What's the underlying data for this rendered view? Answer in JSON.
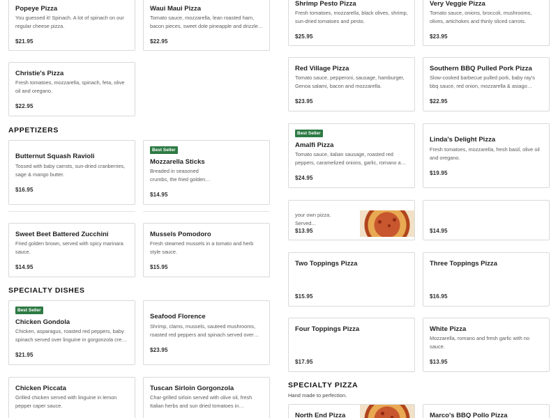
{
  "sections": {
    "appetizers": "APPETIZERS",
    "specialty_dishes": "SPECIALTY DISHES",
    "specialty_pizza": "SPECIALTY PIZZA",
    "specialty_pizza_sub": "Hand made to perfection."
  },
  "badge_label": "Best Seller",
  "items": {
    "popeye": {
      "name": "Popeye Pizza",
      "desc": "You guessed it! Spinach. A lot of spinach on our regular cheese pizza.",
      "price": "$21.95"
    },
    "waui_maui": {
      "name": "Waui Maui Pizza",
      "desc": "Tomato sauce, mozzarella, lean roasted ham, bacon pieces, sweet dole pineapple and drizzle of honey.",
      "price": "$22.95"
    },
    "shrimp_pesto": {
      "name": "Shrimp Pesto Pizza",
      "desc": "Fresh tomatoes, mozzarella, black olives, shrimp, sun-dried tomatoes and pesto.",
      "price": "$25.95"
    },
    "very_veggie": {
      "name": "Very Veggie Pizza",
      "desc": "Tomato sauce, onions, broccoli, mushrooms, olives, artichokes and thinly sliced carrots.",
      "price": "$23.95"
    },
    "christies": {
      "name": "Christie's Pizza",
      "desc": "Fresh tomatoes, mozzarella, spinach, feta, olive oil and oregano.",
      "price": "$22.95"
    },
    "red_village": {
      "name": "Red Village Pizza",
      "desc": "Tomato sauce, pepperoni, sausage, hamburger, Genoa salami, bacon and mozzarella.",
      "price": "$23.95"
    },
    "southern_bbq": {
      "name": "Southern BBQ Pulled Pork Pizza",
      "desc": "Slow-cooked barbecue pulled pork, baby ray's bbq sauce, red onion, mozzarella & asiago cheese.",
      "price": "$22.95"
    },
    "butternut": {
      "name": "Butternut Squash Ravioli",
      "desc": "Tossed with baby carrots, sun-dried cranberries, sage & mango butter.",
      "price": "$16.95"
    },
    "mozzarella_sticks": {
      "name": "Mozzarella Sticks",
      "desc": "Breaded in seasoned crumbs, the fried golden brown.",
      "price": "$14.95"
    },
    "amalfi": {
      "name": "Amalfi Pizza",
      "desc": "Tomato sauce, italian sausage, roasted red peppers, caramelized onions, garlic, romano and mozzarella.",
      "price": "$24.95"
    },
    "lindas": {
      "name": "Linda's Delight Pizza",
      "desc": "Fresh tomatoes, mozzarella, fresh basil, olive oil and oregano.",
      "price": "$19.95"
    },
    "build_own": {
      "desc": "your own pizza. Served...",
      "price": "$13.95"
    },
    "partial_right": {
      "price": "$14.95"
    },
    "sweet_beet": {
      "name": "Sweet Beet Battered Zucchini",
      "desc": "Fried golden brown, served with spicy marinara sauce.",
      "price": "$14.95"
    },
    "mussels": {
      "name": "Mussels Pomodoro",
      "desc": "Fresh steamed mussels in a tomato and herb style sauce.",
      "price": "$15.95"
    },
    "two_toppings": {
      "name": "Two Toppings Pizza",
      "price": "$15.95"
    },
    "three_toppings": {
      "name": "Three Toppings Pizza",
      "price": "$16.95"
    },
    "chicken_gondola": {
      "name": "Chicken Gondola",
      "desc": "Chicken, asparagus, roasted red peppers, baby spinach served over linguine in gorgonzola cream sauce.",
      "price": "$21.95"
    },
    "seafood_florence": {
      "name": "Seafood Florence",
      "desc": "Shrimp, clams, mussels, sauteed mushrooms, roasted red peppers and spinach served over linguine.",
      "price": "$23.95"
    },
    "four_toppings": {
      "name": "Four Toppings Pizza",
      "price": "$17.95"
    },
    "white_pizza": {
      "name": "White Pizza",
      "desc": "Mozzarella, romano and fresh garlic with no sauce.",
      "price": "$13.95"
    },
    "chicken_piccata": {
      "name": "Chicken Piccata",
      "desc": "Grilled chicken served with linguine in lemon pepper caper sauce."
    },
    "tuscan_sirloin": {
      "name": "Tuscan Sirloin Gorgonzola",
      "desc": "Char-grilled sirloin served with olive oil, fresh Italian herbs and sun dried tomatoes in gorgonzola sauce."
    },
    "north_end": {
      "name": "North End Pizza"
    },
    "marcos_bbq": {
      "name": "Marco's BBQ Pollo Pizza"
    }
  },
  "colors": {
    "badge_green": "#2d7a43",
    "border": "#d9d9d9"
  },
  "icons": {
    "food_photo": "pizza-photo"
  }
}
